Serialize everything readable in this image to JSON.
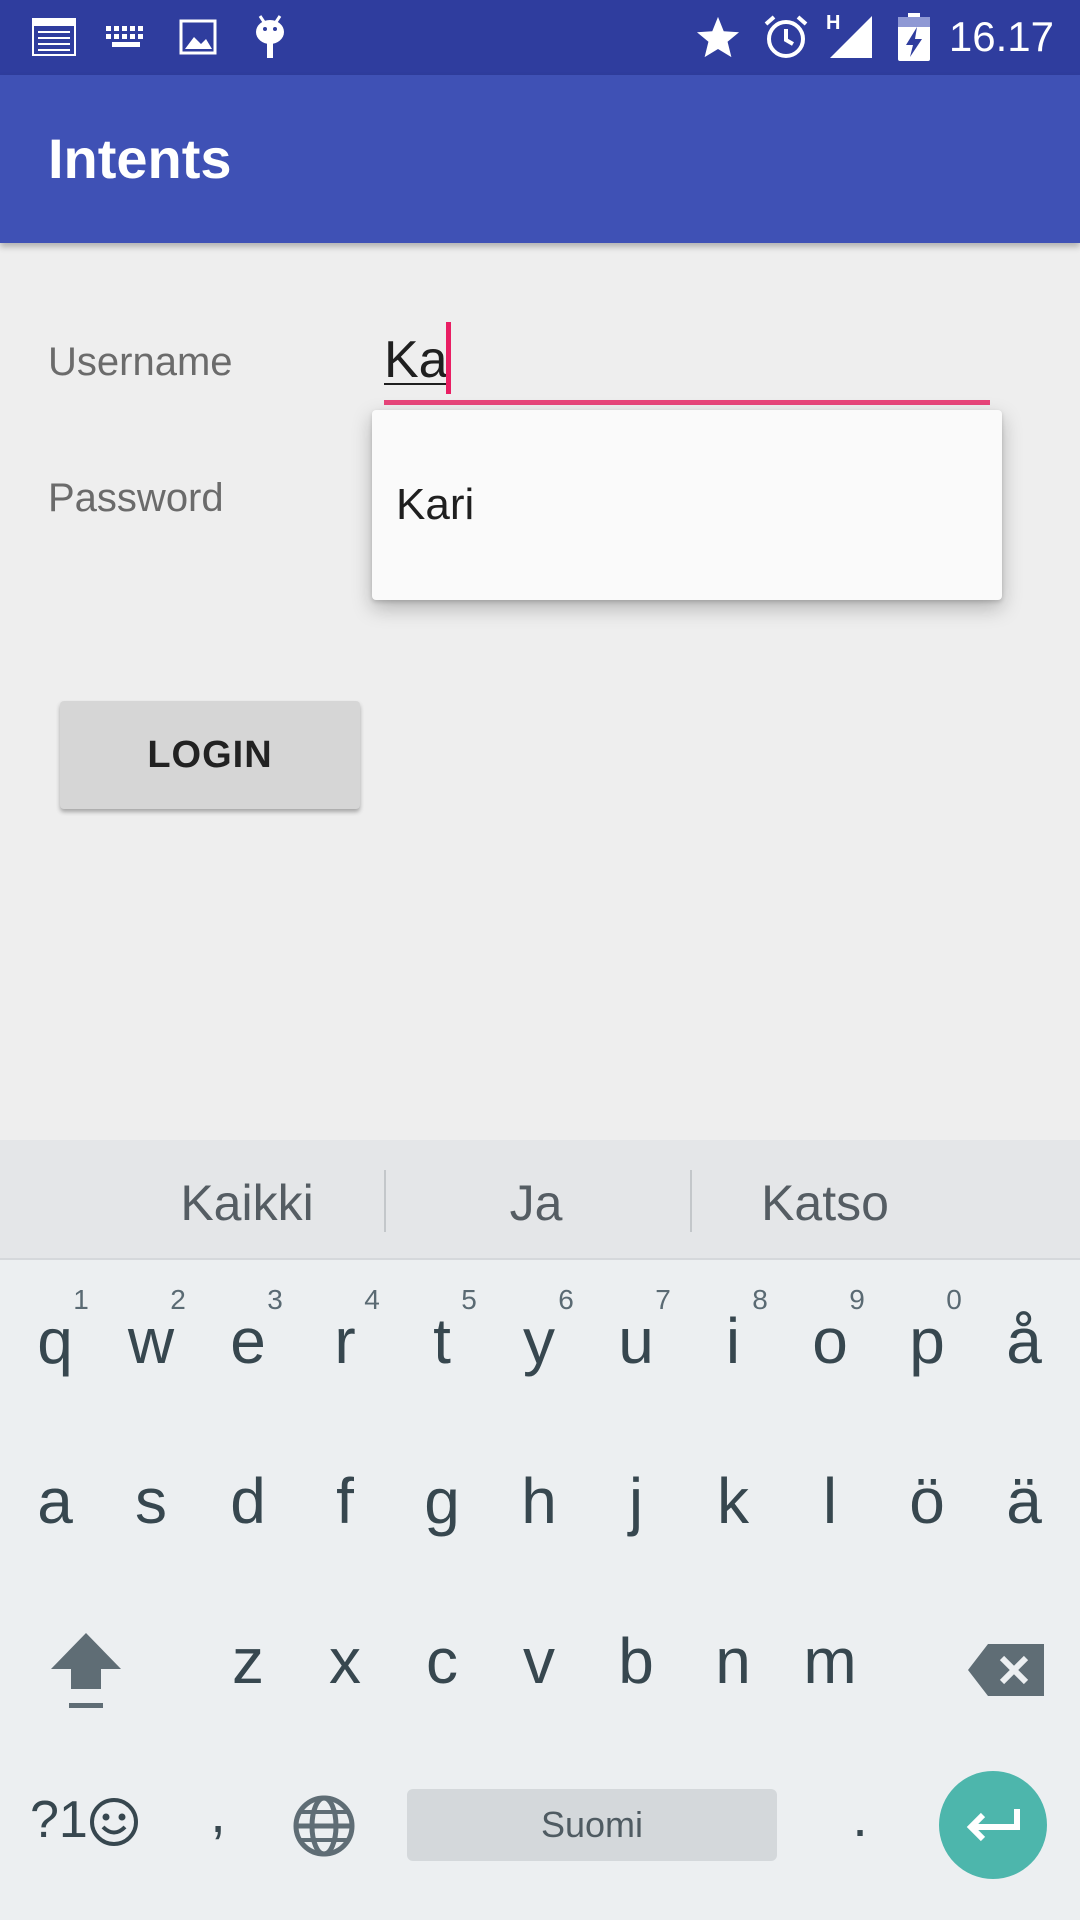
{
  "status_bar": {
    "time": "16.17",
    "network_label": "H",
    "icons": [
      "notes-icon",
      "keyboard-icon",
      "image-icon",
      "android-debug-icon",
      "star-icon",
      "alarm-icon",
      "signal-icon",
      "battery-charging-icon"
    ]
  },
  "app_bar": {
    "title": "Intents"
  },
  "form": {
    "username_label": "Username",
    "username_value": "Ka",
    "password_label": "Password",
    "autocomplete_item": "Kari",
    "login_label": "LOGIN"
  },
  "keyboard": {
    "suggestions": [
      "Kaikki",
      "Ja",
      "Katso"
    ],
    "row1": [
      "q",
      "w",
      "e",
      "r",
      "t",
      "y",
      "u",
      "i",
      "o",
      "p",
      "å"
    ],
    "row1_hints": [
      "1",
      "2",
      "3",
      "4",
      "5",
      "6",
      "7",
      "8",
      "9",
      "0"
    ],
    "row2": [
      "a",
      "s",
      "d",
      "f",
      "g",
      "h",
      "j",
      "k",
      "l",
      "ö",
      "ä"
    ],
    "row3": [
      "z",
      "x",
      "c",
      "v",
      "b",
      "n",
      "m"
    ],
    "symbols_label": "?1",
    "comma": ",",
    "space_label": "Suomi",
    "period": "."
  },
  "colors": {
    "status_bar": "#2f3d9e",
    "app_bar": "#3f51b5",
    "accent": "#e91e63",
    "enter_key": "#4db6ac"
  }
}
